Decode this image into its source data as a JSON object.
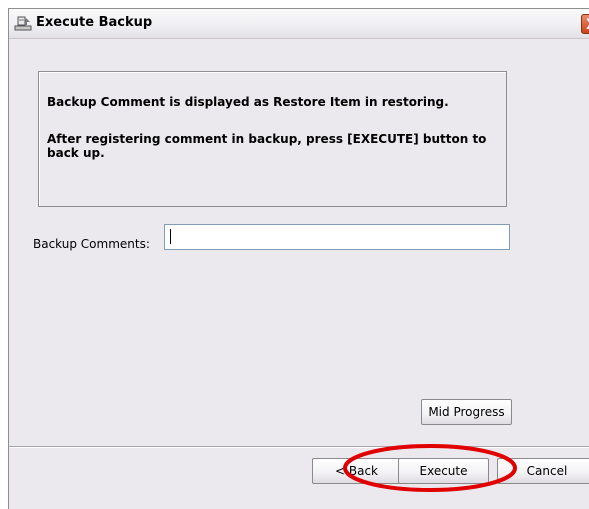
{
  "window": {
    "title": "Execute Backup",
    "close_glyph": "X"
  },
  "info": {
    "line1": "Backup Comment is displayed as Restore Item in restoring.",
    "line2": "After registering comment in backup, press [EXECUTE] button to back up."
  },
  "comments": {
    "label": "Backup Comments:",
    "value": ""
  },
  "buttons": {
    "mid_progress": "Mid Progress",
    "back": "< Back",
    "execute": "Execute",
    "cancel": "Cancel"
  },
  "icons": {
    "title_icon": "backup-app-icon",
    "close_icon": "close-icon"
  },
  "colors": {
    "highlight": "#e00000",
    "close_button": "#c8441d"
  }
}
